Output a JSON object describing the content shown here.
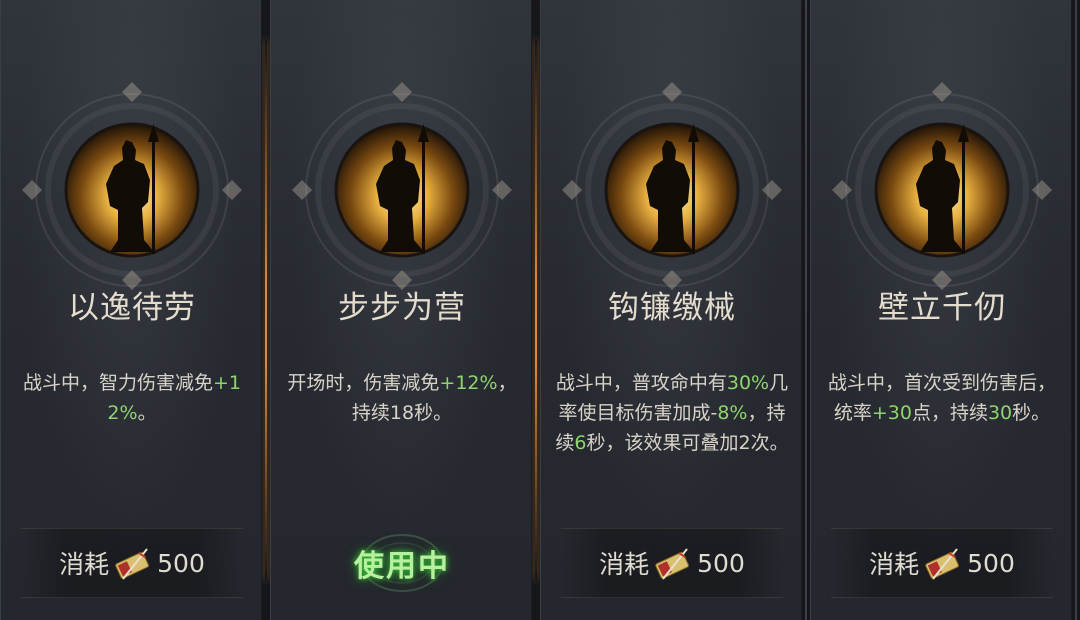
{
  "cards": [
    {
      "title": "以逸待劳",
      "description": [
        {
          "t": "战斗中，智力伤害减免",
          "hl": false
        },
        {
          "t": "+12%",
          "hl": true
        },
        {
          "t": "。",
          "hl": false
        }
      ],
      "state": "cost",
      "cost_label": "消耗",
      "cost_value": "500"
    },
    {
      "title": "步步为营",
      "description": [
        {
          "t": "开场时，伤害减免",
          "hl": false
        },
        {
          "t": "+12%",
          "hl": true
        },
        {
          "t": "，持续18秒。",
          "hl": false
        }
      ],
      "state": "in_use",
      "status_text": "使用中"
    },
    {
      "title": "钩镰缴械",
      "description": [
        {
          "t": "战斗中，普攻命中有",
          "hl": false
        },
        {
          "t": "30%",
          "hl": true
        },
        {
          "t": "几率使目标伤害加成-",
          "hl": false
        },
        {
          "t": "8%",
          "hl": true
        },
        {
          "t": "，持续",
          "hl": false
        },
        {
          "t": "6",
          "hl": true
        },
        {
          "t": "秒，该效果可叠加2次。",
          "hl": false
        }
      ],
      "state": "cost",
      "cost_label": "消耗",
      "cost_value": "500"
    },
    {
      "title": "壁立千仞",
      "description": [
        {
          "t": "战斗中，首次受到伤害后，统率",
          "hl": false
        },
        {
          "t": "+30",
          "hl": true
        },
        {
          "t": "点，持续",
          "hl": false
        },
        {
          "t": "30",
          "hl": true
        },
        {
          "t": "秒。",
          "hl": false
        }
      ],
      "state": "cost",
      "cost_label": "消耗",
      "cost_value": "500"
    }
  ],
  "colors": {
    "highlight": "#8fd46e",
    "title": "#e4dccd",
    "active_separator": "#f0963c",
    "in_use_glow": "#3cdc3c"
  },
  "icons": {
    "emblem": "soldier-silhouette-icon",
    "cost": "token-ticket-icon"
  }
}
